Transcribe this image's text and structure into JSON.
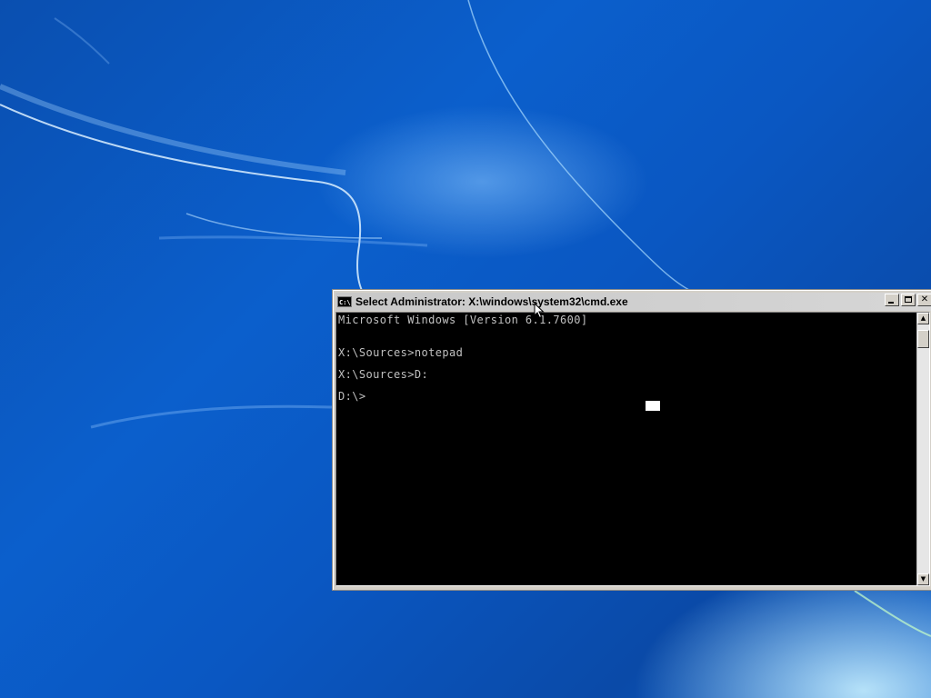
{
  "window": {
    "title": "Select Administrator: X:\\windows\\system32\\cmd.exe",
    "icon_text": "C:\\",
    "controls": {
      "minimize_icon": "minimize-icon",
      "maximize_icon": "maximize-icon",
      "close_glyph": "✕"
    }
  },
  "console": {
    "lines": [
      "Microsoft Windows [Version 6.1.7600]",
      "",
      "X:\\Sources>notepad",
      "X:\\Sources>D:",
      "D:\\>"
    ]
  },
  "scrollbar": {
    "up_glyph": "▲",
    "down_glyph": "▼"
  },
  "colors": {
    "desktop_blue": "#0b5fcc",
    "console_bg": "#000000",
    "console_text": "#c0c0c0",
    "window_chrome": "#d4d0c8"
  }
}
